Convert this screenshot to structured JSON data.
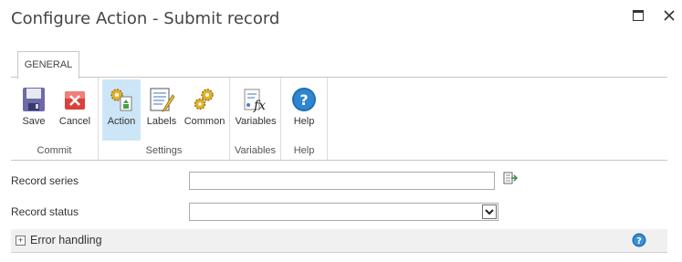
{
  "window": {
    "title": "Configure Action - Submit record",
    "maximize_icon": "maximize-icon",
    "close_icon": "close-icon"
  },
  "ribbon": {
    "tab": "GENERAL",
    "groups": [
      {
        "label": "Commit",
        "buttons": [
          {
            "label": "Save",
            "icon": "save-icon"
          },
          {
            "label": "Cancel",
            "icon": "cancel-icon"
          }
        ]
      },
      {
        "label": "Settings",
        "buttons": [
          {
            "label": "Action",
            "icon": "action-icon",
            "active": true
          },
          {
            "label": "Labels",
            "icon": "labels-icon"
          },
          {
            "label": "Common",
            "icon": "common-icon"
          }
        ]
      },
      {
        "label": "Variables",
        "buttons": [
          {
            "label": "Variables",
            "icon": "variables-icon"
          }
        ]
      },
      {
        "label": "Help",
        "buttons": [
          {
            "label": "Help",
            "icon": "help-icon"
          }
        ]
      }
    ]
  },
  "form": {
    "record_series": {
      "label": "Record series",
      "value": ""
    },
    "record_status": {
      "label": "Record status",
      "value": ""
    }
  },
  "error_handling": {
    "label": "Error handling"
  },
  "colors": {
    "active_button": "#cde6f7",
    "help_blue": "#1f6fb5",
    "cancel_red": "#d9413b",
    "save_purple": "#6c6aa8"
  }
}
